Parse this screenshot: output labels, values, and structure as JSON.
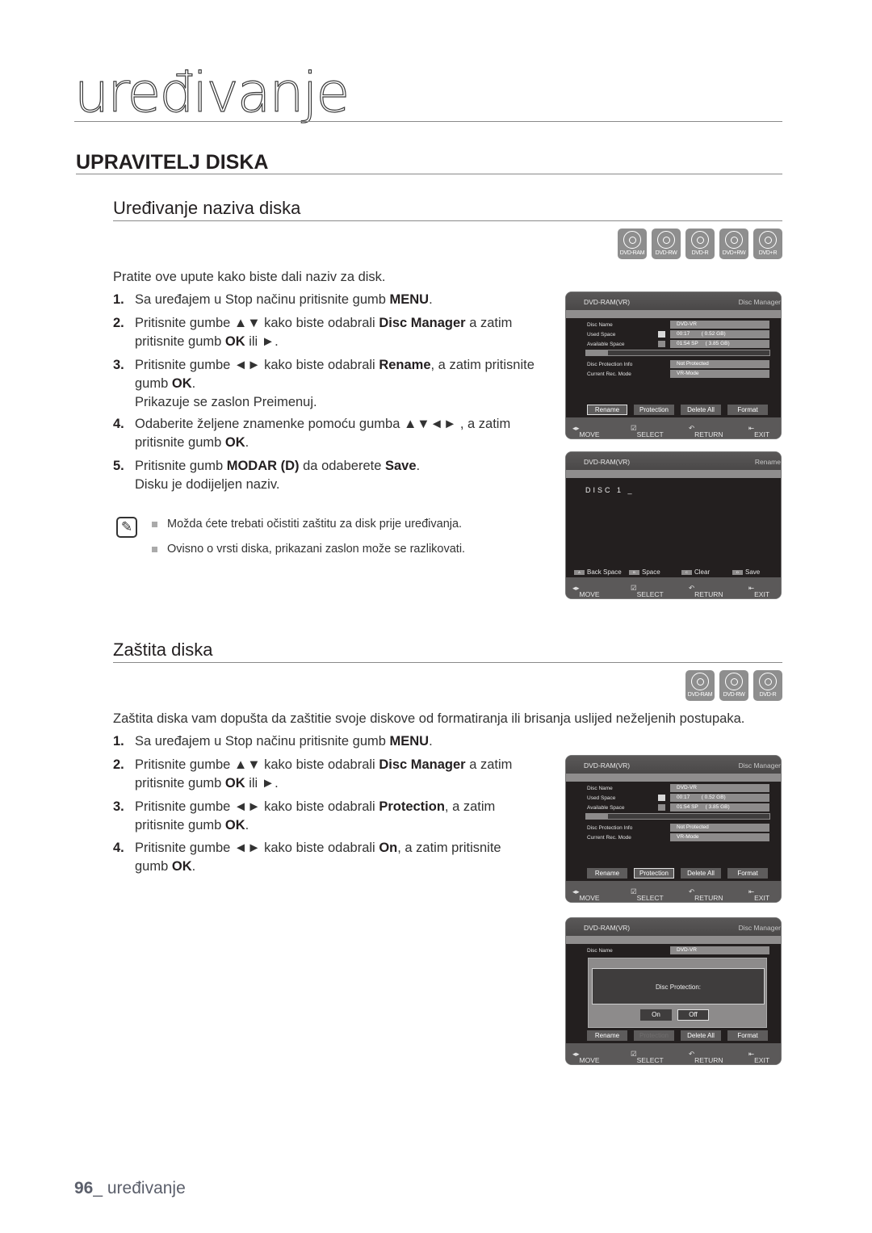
{
  "chapter": {
    "title": "uređivanje"
  },
  "section": {
    "title": "UPRAVITELJ DISKA"
  },
  "rename_section": {
    "title": "Uređivanje naziva diska",
    "disc_types": [
      "DVD-RAM",
      "DVD-RW",
      "DVD-R",
      "DVD+RW",
      "DVD+R"
    ],
    "intro": "Pratite ove upute kako biste dali naziv za disk.",
    "steps": [
      {
        "num": "1.",
        "line1_pre": "Sa uređajem u Stop načinu pritisnite gumb ",
        "line1_b": "MENU",
        "line1_post": "."
      },
      {
        "num": "2.",
        "line1_pre": "Pritisnite gumbe ▲▼ kako biste odabrali ",
        "line1_b": "Disc Manager",
        "line1_post": " a zatim",
        "line2_pre": "pritisnite gumb ",
        "line2_b": "OK",
        "line2_post": " ili ►."
      },
      {
        "num": "3.",
        "line1_pre": "Pritisnite gumbe ◄► kako biste odabrali ",
        "line1_b": "Rename",
        "line1_post": ", a zatim pritisnite",
        "line2_pre": "gumb ",
        "line2_b": "OK",
        "line2_post": ".",
        "line3": "Prikazuje se zaslon Preimenuj."
      },
      {
        "num": "4.",
        "line1_pre": "Odaberite željene znamenke pomoću gumba ▲▼◄► , a zatim",
        "line1_b": "",
        "line1_post": "",
        "line2_pre": "pritisnite gumb ",
        "line2_b": "OK",
        "line2_post": "."
      },
      {
        "num": "5.",
        "line1_pre": "Pritisnite gumb ",
        "line1_b": "MODAR (D)",
        "line1_post": " da odaberete ",
        "line1_b2": "Save",
        "line1_post2": ".",
        "line3": "Disku je dodijeljen naziv."
      }
    ],
    "notes": [
      "Možda ćete trebati očistiti zaštitu za disk prije uređivanja.",
      "Ovisno o vrsti diska, prikazani zaslon može se razlikovati."
    ]
  },
  "protect_section": {
    "title": "Zaštita diska",
    "disc_types": [
      "DVD-RAM",
      "DVD-RW",
      "DVD-R"
    ],
    "intro": "Zaštita diska vam dopušta da zaštitie svoje diskove od formatiranja ili brisanja uslijed neželjenih postupaka.",
    "steps": [
      {
        "num": "1.",
        "line1_pre": "Sa uređajem u Stop načinu pritisnite gumb ",
        "line1_b": "MENU",
        "line1_post": "."
      },
      {
        "num": "2.",
        "line1_pre": "Pritisnite gumbe ▲▼ kako biste odabrali ",
        "line1_b": "Disc Manager",
        "line1_post": " a zatim",
        "line2_pre": "pritisnite gumb ",
        "line2_b": "OK",
        "line2_post": " ili ►."
      },
      {
        "num": "3.",
        "line1_pre": "Pritisnite gumbe ◄► kako biste odabrali ",
        "line1_b": "Protection",
        "line1_post": ", a zatim",
        "line2_pre": "pritisnite gumb ",
        "line2_b": "OK",
        "line2_post": "."
      },
      {
        "num": "4.",
        "line1_pre": "Pritisnite gumbe ◄► kako biste odabrali ",
        "line1_b": "On",
        "line1_post": ", a zatim pritisnite",
        "line2_pre": "gumb ",
        "line2_b": "OK",
        "line2_post": "."
      }
    ]
  },
  "screens": {
    "disc_manager": {
      "source": "DVD-RAM(VR)",
      "title": "Disc Manager",
      "rows": [
        {
          "label": "Disc Name",
          "value": "DVD-VR"
        },
        {
          "label": "Used Space",
          "value": "00:17        ( 0.52 GB)"
        },
        {
          "label": "Available Space",
          "value": "01:54 SP     ( 3.85 GB)"
        },
        {
          "label": "Disc Protection Info",
          "value": "Not Protected"
        },
        {
          "label": "Current Rec. Mode",
          "value": "VR-Mode"
        }
      ],
      "used_fraction": 0.12,
      "used_color": "#d8d8d8",
      "available_color": "#8d8b8b",
      "buttons": [
        "Rename",
        "Protection",
        "Delete All",
        "Format"
      ]
    },
    "rename": {
      "source": "DVD-RAM(VR)",
      "title": "Rename",
      "name_value": "DISC 1 _",
      "color_keys": [
        {
          "key": "A",
          "label": "Back Space"
        },
        {
          "key": "B",
          "label": "Space"
        },
        {
          "key": "C",
          "label": "Clear"
        },
        {
          "key": "D",
          "label": "Save"
        }
      ]
    },
    "protection_popup": {
      "prompt": "Disc Protection:",
      "on_label": "On",
      "off_label": "Off"
    },
    "footer": {
      "move": "MOVE",
      "select": "SELECT",
      "return": "RETURN",
      "exit": "EXIT"
    }
  },
  "page_footer": {
    "number": "96",
    "label": "_ uređivanje"
  }
}
